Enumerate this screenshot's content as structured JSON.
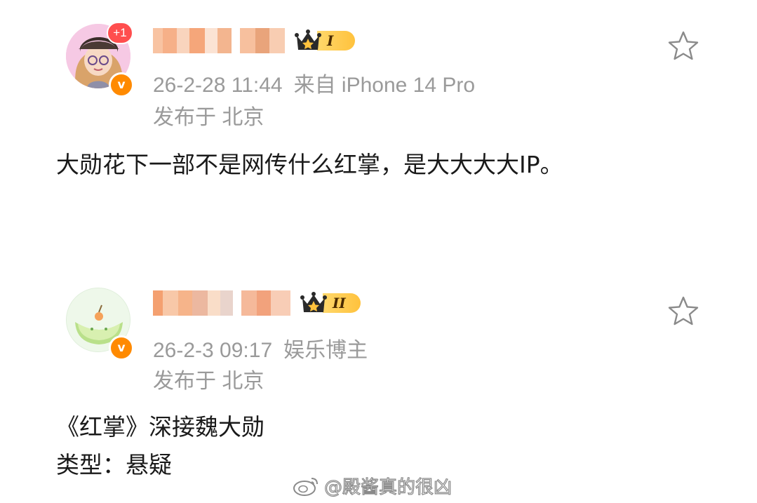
{
  "posts": [
    {
      "avatar_badge": "+1",
      "verified_label": "v",
      "level": "I",
      "timestamp": "26-2-28 11:44",
      "source": "来自 iPhone 14 Pro",
      "location": "发布于 北京",
      "content_lines": [
        "大勋花下一部不是网传什么红掌，是大大大大IP。"
      ],
      "favorite_icon": "star-outline-icon"
    },
    {
      "verified_label": "v",
      "level": "II",
      "timestamp": "26-2-3 09:17",
      "source": "娱乐博主",
      "location": "发布于 北京",
      "content_lines": [
        "《红掌》深接魏大勋",
        "类型：悬疑"
      ],
      "favorite_icon": "star-outline-icon"
    }
  ],
  "watermark": {
    "text": "@殿酱真的很凶",
    "icon": "weibo-logo-icon"
  },
  "colors": {
    "meta_gray": "#9a9a9a",
    "vip_orange": "#ff8a00",
    "badge_red": "#ff4e4e",
    "level_gold": "#ffc23d"
  }
}
